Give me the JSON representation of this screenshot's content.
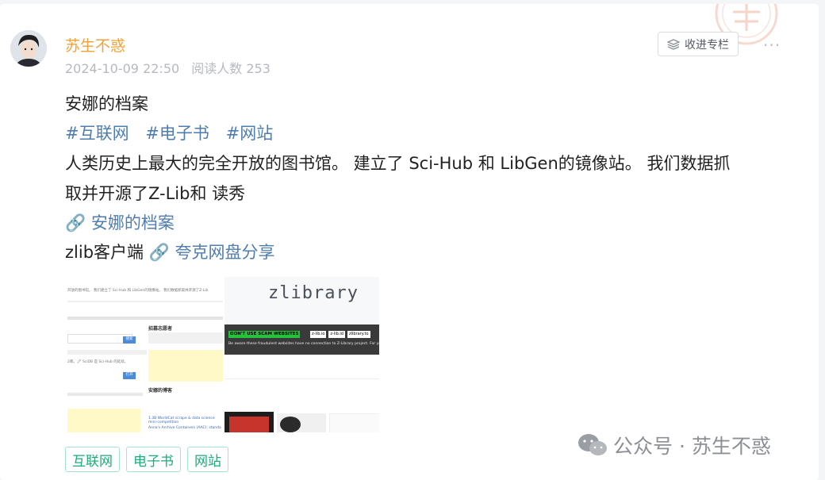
{
  "post": {
    "author": "苏生不惑",
    "date": "2024-10-09 22:50",
    "read_count": "阅读人数 253",
    "follow_label": "收进专栏",
    "more": "···"
  },
  "content": {
    "title": "安娜的档案",
    "hashtags": [
      "#互联网",
      "#电子书",
      "#网站"
    ],
    "desc_line1": "人类历史上最大的完全开放的图书馆。   建立了 Sci-Hub 和 LibGen的镜像站。 我们数据抓",
    "desc_line2": "取并开源了Z-Lib和 读秀",
    "link1": "🔗 安娜的档案",
    "client_label": "zlib客户端",
    "link2": "🔗 夸克网盘分享"
  },
  "screenshot_right": {
    "logo": "zlibrary",
    "warning": "DON'T USE SCAM WEBSITES",
    "warn_sites": [
      "z-lib.io",
      "z-lib.id",
      "zlibrary.to"
    ],
    "banner": "Be aware these fraudulent websites have no connection to Z-Library project. For your"
  },
  "screenshot_left": {
    "top_text": "开放的图书馆。 我们建立了 Sci-Hub 和 LibGen的镜像站。 我们数据抓取并开源了Z-Lib",
    "volunteer_title": "招募志愿者",
    "blog_title": "安娜的博客",
    "blog_items": [
      "1.3B WorldCat scrape & data science mini-competition",
      "Anna's Archive Containers (AAC): standa"
    ],
    "search_btn": "搜索",
    "open_btn": "打开",
    "scihub_text": "2库。🖋 SciDB 是 Sci-Hub 的延续。"
  },
  "chips": [
    "互联网",
    "电子书",
    "网站"
  ],
  "watermark": "公众号 · 苏生不惑",
  "colors": {
    "author": "#f0a23a",
    "link": "#507daf",
    "chip_text": "#1aad79",
    "chip_border": "#a7e3d2"
  }
}
